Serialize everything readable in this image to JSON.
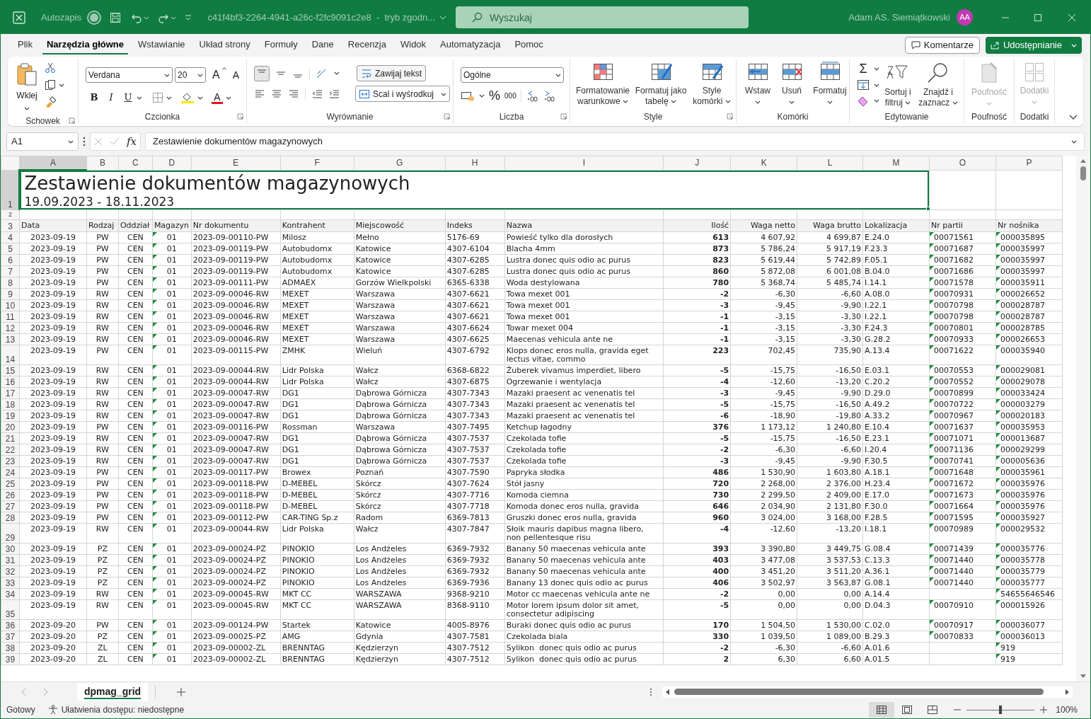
{
  "title_bar": {
    "autosave_label": "Autozapis",
    "autosave_on": false,
    "filename": "c41f4bf3-2264-4941-a26c-f2fc9091c2e8  -  tryb zgodn...",
    "search_placeholder": "Wyszukaj",
    "user_name": "Adam AS. Siemiątkowski",
    "avatar_initials": "AA"
  },
  "menu_tabs": [
    {
      "label": "Plik",
      "selected": false
    },
    {
      "label": "Narzędzia główne",
      "selected": true
    },
    {
      "label": "Wstawianie",
      "selected": false
    },
    {
      "label": "Układ strony",
      "selected": false
    },
    {
      "label": "Formuły",
      "selected": false
    },
    {
      "label": "Dane",
      "selected": false
    },
    {
      "label": "Recenzja",
      "selected": false
    },
    {
      "label": "Widok",
      "selected": false
    },
    {
      "label": "Automatyzacja",
      "selected": false
    },
    {
      "label": "Pomoc",
      "selected": false
    }
  ],
  "comments_button": "Komentarze",
  "share_button": "Udostępnianie",
  "ribbon": {
    "clipboard": {
      "paste": "Wklej",
      "label": "Schowek"
    },
    "font": {
      "name": "Verdana",
      "size": "20",
      "grow": "A",
      "shrink": "A",
      "style_buttons": [
        "B",
        "I",
        "U"
      ],
      "color_glyph": "A",
      "label": "Czcionka"
    },
    "alignment": {
      "wrap": "Zawijaj tekst",
      "merge": "Scal i wyśrodkuj",
      "label": "Wyrównanie"
    },
    "number": {
      "format": "Ogólne",
      "percent": "%",
      "thousands": "000",
      "label": "Liczba"
    },
    "styles": {
      "buttons": [
        "Formatowanie warunkowe",
        "Formatuj jako tabelę",
        "Style komórki"
      ],
      "label": "Style"
    },
    "cells": {
      "buttons": [
        "Wstaw",
        "Usuń",
        "Formatuj"
      ],
      "label": "Komórki"
    },
    "editing": {
      "sum": "Σ",
      "buttons": [
        "Sortuj i filtruj",
        "Znajdź i zaznacz"
      ],
      "label": "Edytowanie"
    },
    "sensitivity": {
      "button": "Poufność",
      "label": "Poufność",
      "disabled": true
    },
    "addins": {
      "button": "Dodatki",
      "label": "Dodatki",
      "disabled": true
    }
  },
  "formula_bar": {
    "name_box": "A1",
    "fx_label": "fx",
    "content": "Zestawienie dokumentów magazynowych"
  },
  "sheet": {
    "title_selected": true,
    "title": "Zestawienie dokumentów magazynowych",
    "subtitle": "19.09.2023 - 18.11.2023",
    "header_row_numbers": [
      "1",
      "2",
      "3"
    ],
    "columns": [
      {
        "letter": "A",
        "header": "Data",
        "warning": false
      },
      {
        "letter": "B",
        "header": "Rodzaj",
        "warning": false
      },
      {
        "letter": "C",
        "header": "Oddział",
        "warning": false
      },
      {
        "letter": "D",
        "header": "Magazyn",
        "warning": true
      },
      {
        "letter": "E",
        "header": "Nr dokumentu",
        "warning": false
      },
      {
        "letter": "F",
        "header": "Kontrahent",
        "warning": false
      },
      {
        "letter": "G",
        "header": "Miejscowość",
        "warning": false
      },
      {
        "letter": "H",
        "header": "Indeks",
        "warning": false
      },
      {
        "letter": "I",
        "header": "Nazwa",
        "warning": false
      },
      {
        "letter": "J",
        "header": "Ilość",
        "warning": false
      },
      {
        "letter": "K",
        "header": "Waga netto",
        "warning": false
      },
      {
        "letter": "L",
        "header": "Waga brutto",
        "warning": false
      },
      {
        "letter": "M",
        "header": "Lokalizacja",
        "warning": false
      },
      {
        "letter": "O",
        "header": "Nr partii",
        "warning": true
      },
      {
        "letter": "P",
        "header": "Nr nośnika",
        "warning": true
      }
    ],
    "rows": [
      {
        "row": "4",
        "cells": [
          "2023-09-19",
          "PW",
          "CEN",
          "01",
          "2023-09-00110-PW",
          "Milosz",
          "Mełno",
          "5176-69",
          "Powieść tylko dla dorosłych",
          "613",
          "4 607,92",
          "4 699,87",
          "E.24.0",
          "00071561",
          "000035895"
        ]
      },
      {
        "row": "5",
        "cells": [
          "2023-09-19",
          "PW",
          "CEN",
          "01",
          "2023-09-00119-PW",
          "Autobudomx",
          "Katowice",
          "4307-6104",
          "Blacha 4mm",
          "873",
          "5 786,24",
          "5 917,19",
          "F.23.3",
          "00071687",
          "000035997"
        ]
      },
      {
        "row": "6",
        "cells": [
          "2023-09-19",
          "PW",
          "CEN",
          "01",
          "2023-09-00119-PW",
          "Autobudomx",
          "Katowice",
          "4307-6285",
          "Lustra donec quis odio ac purus",
          "823",
          "5 619,44",
          "5 742,89",
          "F.05.1",
          "00071682",
          "000035997"
        ]
      },
      {
        "row": "7",
        "cells": [
          "2023-09-19",
          "PW",
          "CEN",
          "01",
          "2023-09-00119-PW",
          "Autobudomx",
          "Katowice",
          "4307-6285",
          "Lustra donec quis odio ac purus",
          "860",
          "5 872,08",
          "6 001,08",
          "B.04.0",
          "00071686",
          "000035997"
        ]
      },
      {
        "row": "8",
        "cells": [
          "2023-09-19",
          "PW",
          "CEN",
          "01",
          "2023-09-00111-PW",
          "ADMAEX",
          "Gorzów Wielkpolski",
          "6365-6338",
          "Woda destylowana",
          "780",
          "5 368,74",
          "5 485,74",
          "I.14.1",
          "00071578",
          "000035911"
        ]
      },
      {
        "row": "9",
        "cells": [
          "2023-09-19",
          "RW",
          "CEN",
          "01",
          "2023-09-00046-RW",
          "MEXET",
          "Warszawa",
          "4307-6621",
          "Towa mexet 001",
          "-2",
          "-6,30",
          "-6,60",
          "A.08.0",
          "00070931",
          "000026652"
        ]
      },
      {
        "row": "10",
        "cells": [
          "2023-09-19",
          "RW",
          "CEN",
          "01",
          "2023-09-00046-RW",
          "MEXET",
          "Warszawa",
          "4307-6621",
          "Towa mexet 001",
          "-3",
          "-9,45",
          "-9,90",
          "I.22.1",
          "00070798",
          "000028787"
        ]
      },
      {
        "row": "11",
        "cells": [
          "2023-09-19",
          "RW",
          "CEN",
          "01",
          "2023-09-00046-RW",
          "MEXET",
          "Warszawa",
          "4307-6621",
          "Towa mexet 001",
          "-1",
          "-3,15",
          "-3,30",
          "I.22.1",
          "00070798",
          "000028787"
        ]
      },
      {
        "row": "12",
        "cells": [
          "2023-09-19",
          "RW",
          "CEN",
          "01",
          "2023-09-00046-RW",
          "MEXET",
          "Warszawa",
          "4307-6624",
          "Towar mexet 004",
          "-1",
          "-3,15",
          "-3,30",
          "F.24.3",
          "00070801",
          "000028785"
        ]
      },
      {
        "row": "13",
        "cells": [
          "2023-09-19",
          "RW",
          "CEN",
          "01",
          "2023-09-00046-RW",
          "MEXET",
          "Warszawa",
          "4307-6625",
          "Maecenas vehicula ante ne",
          "-1",
          "-3,15",
          "-3,30",
          "G.28.2",
          "00070933",
          "000026653"
        ]
      },
      {
        "row": "14",
        "cells": [
          "2023-09-19",
          "PW",
          "CEN",
          "01",
          "2023-09-00115-PW",
          "ZMHK",
          "Wieluń",
          "4307-6792",
          "Klops donec eros nulla, gravida eget lectus vitae, commo",
          "223",
          "702,45",
          "735,90",
          "A.13.4",
          "00071622",
          "000035940"
        ]
      },
      {
        "row": "15",
        "cells": [
          "2023-09-19",
          "RW",
          "CEN",
          "01",
          "2023-09-00044-RW",
          "Lidr Polska",
          "Wałcz",
          "6368-6822",
          "Żuberek vivamus imperdiet, libero",
          "-5",
          "-15,75",
          "-16,50",
          "E.03.1",
          "00070553",
          "000029081"
        ]
      },
      {
        "row": "16",
        "cells": [
          "2023-09-19",
          "RW",
          "CEN",
          "01",
          "2023-09-00044-RW",
          "Lidr Polska",
          "Wałcz",
          "4307-6875",
          "Ogrzewanie i wentylacja",
          "-4",
          "-12,60",
          "-13,20",
          "C.20.2",
          "00070552",
          "000029078"
        ]
      },
      {
        "row": "17",
        "cells": [
          "2023-09-19",
          "RW",
          "CEN",
          "01",
          "2023-09-00047-RW",
          "DG1",
          "Dąbrowa Górnicza",
          "4307-7343",
          "Mazaki praesent ac venenatis tel",
          "-3",
          "-9,45",
          "-9,90",
          "D.29.0",
          "00070899",
          "000033424"
        ]
      },
      {
        "row": "18",
        "cells": [
          "2023-09-19",
          "RW",
          "CEN",
          "01",
          "2023-09-00047-RW",
          "DG1",
          "Dąbrowa Górnicza",
          "4307-7343",
          "Mazaki praesent ac venenatis tel",
          "-5",
          "-15,75",
          "-16,50",
          "A.49.2",
          "00070722",
          "000003279"
        ]
      },
      {
        "row": "19",
        "cells": [
          "2023-09-19",
          "RW",
          "CEN",
          "01",
          "2023-09-00047-RW",
          "DG1",
          "Dąbrowa Górnicza",
          "4307-7343",
          "Mazaki praesent ac venenatis tel",
          "-6",
          "-18,90",
          "-19,80",
          "A.33.2",
          "00070967",
          "000020183"
        ]
      },
      {
        "row": "20",
        "cells": [
          "2023-09-19",
          "PW",
          "CEN",
          "01",
          "2023-09-00116-PW",
          "Rossman",
          "Warszawa",
          "4307-7495",
          "Ketchup łagodny",
          "376",
          "1 173,12",
          "1 240,80",
          "E.10.4",
          "00071637",
          "000035953"
        ]
      },
      {
        "row": "21",
        "cells": [
          "2023-09-19",
          "RW",
          "CEN",
          "01",
          "2023-09-00047-RW",
          "DG1",
          "Dąbrowa Górnicza",
          "4307-7537",
          "Czekolada tofie",
          "-5",
          "-15,75",
          "-16,50",
          "E.23.1",
          "00071071",
          "000013687"
        ]
      },
      {
        "row": "22",
        "cells": [
          "2023-09-19",
          "RW",
          "CEN",
          "01",
          "2023-09-00047-RW",
          "DG1",
          "Dąbrowa Górnicza",
          "4307-7537",
          "Czekolada tofie",
          "-2",
          "-6,30",
          "-6,60",
          "I.20.4",
          "00071136",
          "000029299"
        ]
      },
      {
        "row": "23",
        "cells": [
          "2023-09-19",
          "RW",
          "CEN",
          "01",
          "2023-09-00047-RW",
          "DG1",
          "Dąbrowa Górnicza",
          "4307-7537",
          "Czekolada tofie",
          "-3",
          "-9,45",
          "-9,90",
          "F.30.5",
          "00070741",
          "000005636"
        ]
      },
      {
        "row": "24",
        "cells": [
          "2023-09-19",
          "PW",
          "CEN",
          "01",
          "2023-09-00117-PW",
          "Browex",
          "Poznań",
          "4307-7590",
          "Papryka słodka",
          "486",
          "1 530,90",
          "1 603,80",
          "A.18.1",
          "00071648",
          "000035961"
        ]
      },
      {
        "row": "25",
        "cells": [
          "2023-09-19",
          "PW",
          "CEN",
          "01",
          "2023-09-00118-PW",
          "D-MEBEL",
          "Skórcz",
          "4307-7624",
          "Stół jasny",
          "720",
          "2 268,00",
          "2 376,00",
          "H.23.4",
          "00071672",
          "000035976"
        ]
      },
      {
        "row": "26",
        "cells": [
          "2023-09-19",
          "PW",
          "CEN",
          "01",
          "2023-09-00118-PW",
          "D-MEBEL",
          "Skórcz",
          "4307-7716",
          "Komoda ciemna",
          "730",
          "2 299,50",
          "2 409,00",
          "E.17.0",
          "00071673",
          "000035976"
        ]
      },
      {
        "row": "27",
        "cells": [
          "2023-09-19",
          "PW",
          "CEN",
          "01",
          "2023-09-00118-PW",
          "D-MEBEL",
          "Skórcz",
          "4307-7718",
          "Komoda donec eros nulla, gravida",
          "646",
          "2 034,90",
          "2 131,80",
          "F.30.0",
          "00071664",
          "000035976"
        ]
      },
      {
        "row": "28",
        "cells": [
          "2023-09-19",
          "PW",
          "CEN",
          "01",
          "2023-09-00112-PW",
          "CAR-TING Sp.z",
          "Radom",
          "6369-7813",
          "Gruszki donec eros nulla, gravida",
          "960",
          "3 024,00",
          "3 168,00",
          "F.28.5",
          "00071595",
          "000035927"
        ]
      },
      {
        "row": "29",
        "cells": [
          "2023-09-19",
          "RW",
          "CEN",
          "01",
          "2023-09-00044-RW",
          "Lidr Polska",
          "Wałcz",
          "4307-7847",
          "Słoik mauris dapibus magna libero, non pellentesque risu",
          "-4",
          "-12,60",
          "-13,20",
          "I.18.1",
          "00070989",
          "000029532"
        ]
      },
      {
        "row": "30",
        "cells": [
          "2023-09-19",
          "PZ",
          "CEN",
          "01",
          "2023-09-00024-PZ",
          "PINOKIO",
          "Los Andżeles",
          "6369-7932",
          "Banany 50 maecenas vehicula ante",
          "393",
          "3 390,80",
          "3 449,75",
          "G.08.4",
          "00071439",
          "000035776"
        ]
      },
      {
        "row": "31",
        "cells": [
          "2023-09-19",
          "PZ",
          "CEN",
          "01",
          "2023-09-00024-PZ",
          "PINOKIO",
          "Los Andżeles",
          "6369-7932",
          "Banany 50 maecenas vehicula ante",
          "403",
          "3 477,08",
          "3 537,53",
          "C.13.3",
          "00071440",
          "000035778"
        ]
      },
      {
        "row": "32",
        "cells": [
          "2023-09-19",
          "PZ",
          "CEN",
          "01",
          "2023-09-00024-PZ",
          "PINOKIO",
          "Los Andżeles",
          "6369-7932",
          "Banany 50 maecenas vehicula ante",
          "400",
          "3 451,20",
          "3 511,20",
          "A.36.1",
          "00071440",
          "000035779"
        ]
      },
      {
        "row": "33",
        "cells": [
          "2023-09-19",
          "PZ",
          "CEN",
          "01",
          "2023-09-00024-PZ",
          "PINOKIO",
          "Los Andżeles",
          "6369-7936",
          "Banany 13 donec quis odio ac purus",
          "406",
          "3 502,97",
          "3 563,87",
          "G.08.1",
          "00071440",
          "000035777"
        ]
      },
      {
        "row": "34",
        "cells": [
          "2023-09-19",
          "RW",
          "CEN",
          "01",
          "2023-09-00045-RW",
          "MKT CC",
          "WARSZAWA",
          "9368-9210",
          "Motor cc maecenas vehicula ante ne",
          "-2",
          "0,00",
          "0,00",
          "A.14.4",
          null,
          "54655646546"
        ]
      },
      {
        "row": "35",
        "cells": [
          "2023-09-19",
          "RW",
          "CEN",
          "01",
          "2023-09-00045-RW",
          "MKT CC",
          "WARSZAWA",
          "8368-9110",
          "Motor lorem ipsum dolor sit amet, consectetur adipiscing",
          "-5",
          "0,00",
          "0,00",
          "D.04.3",
          "00070910",
          "000015926"
        ]
      },
      {
        "row": "36",
        "cells": [
          "2023-09-20",
          "PW",
          "CEN",
          "01",
          "2023-09-00124-PW",
          "Startek",
          "Katowice",
          "4005-8976",
          "Buraki donec quis odio ac purus",
          "170",
          "1 504,50",
          "1 530,00",
          "C.02.0",
          "00070917",
          "000036077"
        ]
      },
      {
        "row": "37",
        "cells": [
          "2023-09-20",
          "PZ",
          "CEN",
          "01",
          "2023-09-00025-PZ",
          "AMG",
          "Gdynia",
          "4307-7581",
          "Czekolada biala",
          "330",
          "1 039,50",
          "1 089,00",
          "B.29.3",
          "00070833",
          "000036013"
        ]
      },
      {
        "row": "38",
        "cells": [
          "2023-09-20",
          "ZL",
          "CEN",
          "01",
          "2023-09-00002-ZL",
          "BRENNTAG",
          "Kędzierzyn",
          "4307-7512",
          "Sylikon  donec quis odio ac purus",
          "-2",
          "-6,30",
          "-6,60",
          "A.01.6",
          null,
          "919"
        ]
      },
      {
        "row": "39",
        "cells": [
          "2023-09-20",
          "ZL",
          "CEN",
          "01",
          "2023-09-00002-ZL",
          "BRENNTAG",
          "Kędzierzyn",
          "4307-7512",
          "Sylikon  donec quis odio ac purus",
          "2",
          "6,30",
          "6,60",
          "A.01.5",
          null,
          "919"
        ]
      }
    ]
  },
  "sheet_tabs": [
    {
      "label": "dpmag_grid",
      "selected": true
    }
  ],
  "status_bar": {
    "ready": "Gotowy",
    "accessibility": "Ułatwienia dostępu: niedostępne",
    "views": [
      {
        "kind": "normal",
        "selected": true
      },
      {
        "kind": "page_layout",
        "selected": false
      },
      {
        "kind": "page_break",
        "selected": false
      }
    ],
    "zoom_slider": {
      "level": 0.5
    },
    "zoom": "100%"
  }
}
